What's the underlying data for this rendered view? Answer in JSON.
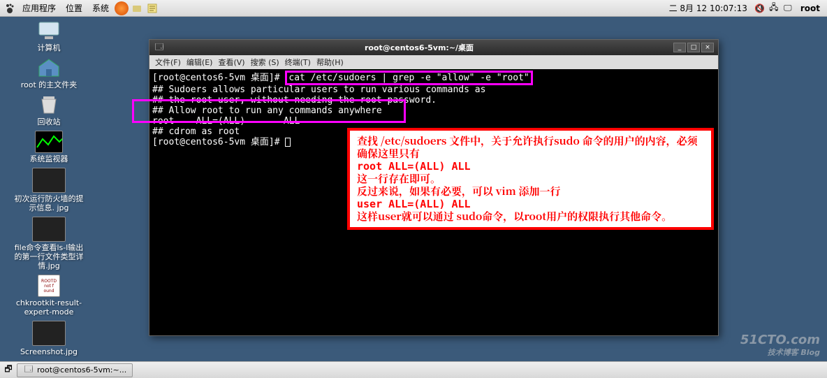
{
  "panel": {
    "apps": "应用程序",
    "places": "位置",
    "system": "系统",
    "clock": "二  8月  12 10:07:13",
    "user": "root"
  },
  "desktop": {
    "computer": "计算机",
    "home": "root 的主文件夹",
    "trash": "回收站",
    "sysmonitor": "系统监视器",
    "fw": "初次运行防火墙的提示信息. jpg",
    "lscmd": "file命令查看ls-l输出的第一行文件类型详情.jpg",
    "chk": "chkrootkit-result-expert-mode",
    "ss": "Screenshot.jpg"
  },
  "term": {
    "title": "root@centos6-5vm:~/桌面",
    "menu": {
      "file": "文件(F)",
      "edit": "编辑(E)",
      "view": "查看(V)",
      "search": "搜索 (S)",
      "terminal": "终端(T)",
      "help": "帮助(H)"
    },
    "prompt1": "[root@centos6-5vm 桌面]# ",
    "cmd": "cat /etc/sudoers | grep -e \"allow\" -e \"root\"",
    "l1": "## Sudoers allows particular users to run various commands as",
    "l2": "## the root user, without needing the root password.",
    "l3": "## Allow root to run any commands anywhere",
    "l4": "root    ALL=(ALL)       ALL",
    "l5": "## cdrom as root",
    "prompt2": "[root@centos6-5vm 桌面]# "
  },
  "anno": {
    "a1": "查找 /etc/sudoers 文件中，关于允许执行sudo 命令的用户的内容，必须确保这里只有",
    "a2": "root  ALL=(ALL)    ALL",
    "a3": "这一行存在即可。",
    "a4": "反过来说，如果有必要，可以 vim 添加一行",
    "a5": "user  ALL=(ALL) ALL",
    "a6": "这样user就可以通过 sudo命令，以root用户的权限执行其他命令。"
  },
  "taskbar": {
    "task1": "root@centos6-5vm:~..."
  },
  "watermark": {
    "main": "51CTO.com",
    "sub": "技术博客    Blog"
  }
}
